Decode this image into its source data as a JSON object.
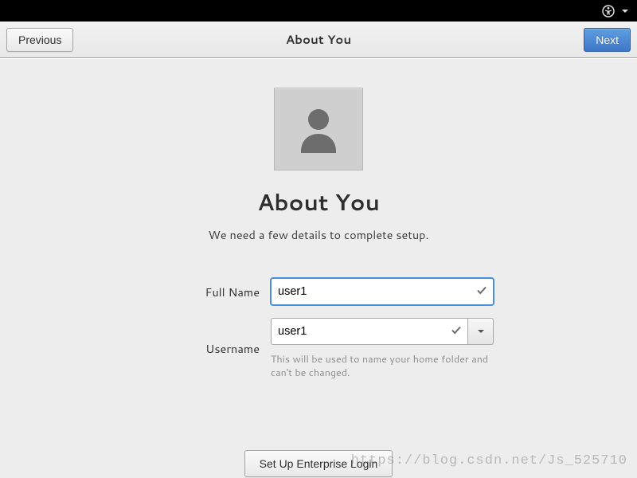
{
  "header": {
    "previous_label": "Previous",
    "title": "About You",
    "next_label": "Next"
  },
  "main": {
    "heading": "About You",
    "subtitle": "We need a few details to complete setup.",
    "fullname_label": "Full Name",
    "fullname_value": "user1",
    "username_label": "Username",
    "username_value": "user1",
    "username_hint": "This will be used to name your home folder and can't be changed.",
    "enterprise_label": "Set Up Enterprise Login"
  },
  "watermark": "https://blog.csdn.net/Js_525710"
}
